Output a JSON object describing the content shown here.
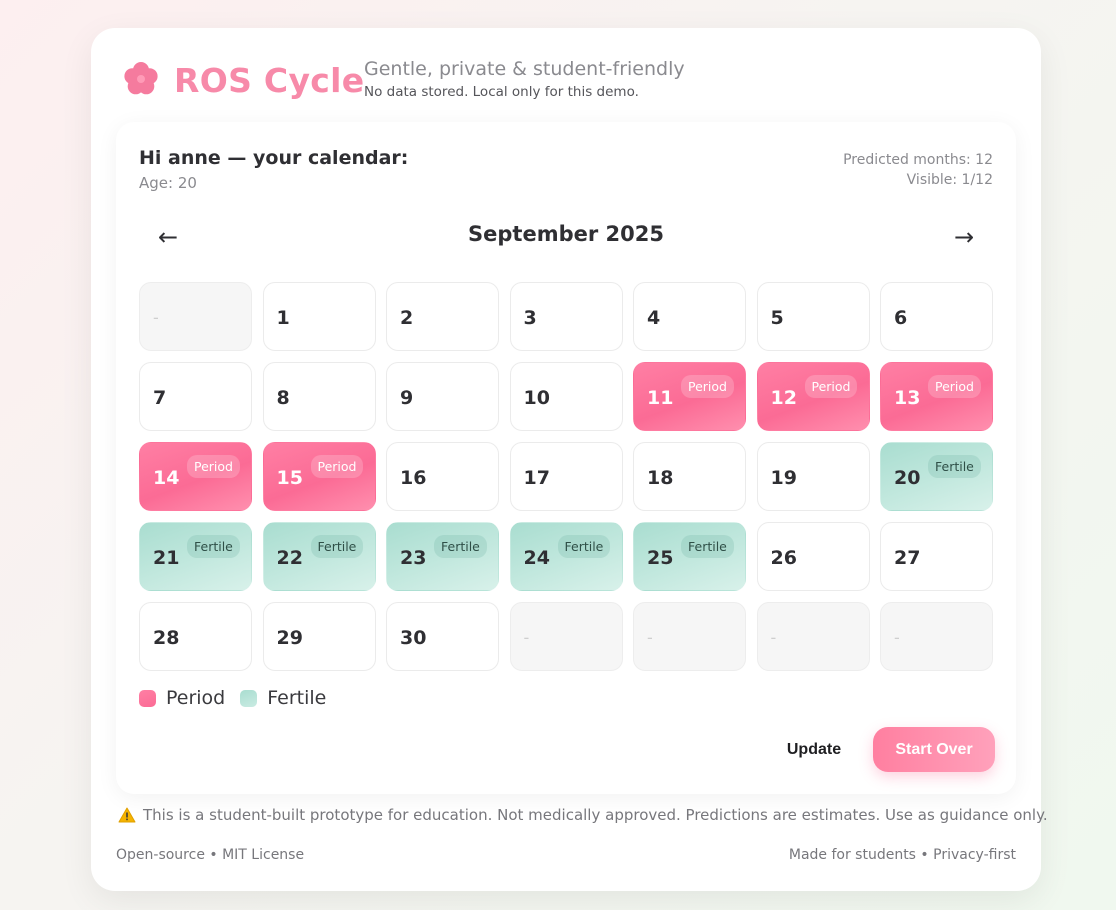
{
  "header": {
    "brand_name": "ROS Cycle",
    "tagline": "Gentle, private & student-friendly",
    "subtagline": "No data stored. Local only for this demo.",
    "brand_color": "#f78aa9",
    "brand_icon": "flower-icon"
  },
  "greeting": {
    "title": "Hi anne — your calendar:",
    "age": "Age: 20"
  },
  "meta": {
    "predicted": "Predicted months: 12",
    "visible": "Visible: 1/12"
  },
  "nav": {
    "prev": "←",
    "next": "→",
    "month": "September 2025"
  },
  "calendar": {
    "empty_placeholder": "-",
    "days": [
      {
        "num": "-",
        "type": "empty"
      },
      {
        "num": "1",
        "type": "normal"
      },
      {
        "num": "2",
        "type": "normal"
      },
      {
        "num": "3",
        "type": "normal"
      },
      {
        "num": "4",
        "type": "normal"
      },
      {
        "num": "5",
        "type": "normal"
      },
      {
        "num": "6",
        "type": "normal"
      },
      {
        "num": "7",
        "type": "normal"
      },
      {
        "num": "8",
        "type": "normal"
      },
      {
        "num": "9",
        "type": "normal"
      },
      {
        "num": "10",
        "type": "normal"
      },
      {
        "num": "11",
        "type": "period",
        "badge": "Period"
      },
      {
        "num": "12",
        "type": "period",
        "badge": "Period"
      },
      {
        "num": "13",
        "type": "period",
        "badge": "Period"
      },
      {
        "num": "14",
        "type": "period",
        "badge": "Period"
      },
      {
        "num": "15",
        "type": "period",
        "badge": "Period"
      },
      {
        "num": "16",
        "type": "normal"
      },
      {
        "num": "17",
        "type": "normal"
      },
      {
        "num": "18",
        "type": "normal"
      },
      {
        "num": "19",
        "type": "normal"
      },
      {
        "num": "20",
        "type": "fertile",
        "badge": "Fertile"
      },
      {
        "num": "21",
        "type": "fertile",
        "badge": "Fertile"
      },
      {
        "num": "22",
        "type": "fertile",
        "badge": "Fertile"
      },
      {
        "num": "23",
        "type": "fertile",
        "badge": "Fertile"
      },
      {
        "num": "24",
        "type": "fertile",
        "badge": "Fertile"
      },
      {
        "num": "25",
        "type": "fertile",
        "badge": "Fertile"
      },
      {
        "num": "26",
        "type": "normal"
      },
      {
        "num": "27",
        "type": "normal"
      },
      {
        "num": "28",
        "type": "normal"
      },
      {
        "num": "29",
        "type": "normal"
      },
      {
        "num": "30",
        "type": "normal"
      },
      {
        "num": "-",
        "type": "empty"
      },
      {
        "num": "-",
        "type": "empty"
      },
      {
        "num": "-",
        "type": "empty"
      },
      {
        "num": "-",
        "type": "empty"
      }
    ]
  },
  "legend": {
    "period": "Period",
    "fertile": "Fertile",
    "period_color": "#fb6b95",
    "fertile_color": "#a9ddd0"
  },
  "actions": {
    "update": "Update",
    "start_over": "Start Over"
  },
  "footer": {
    "disclaimer_icon": "warning-icon",
    "disclaimer": "This is a student-built prototype for education. Not medically approved. Predictions are estimates. Use as guidance only.",
    "left": "Open-source • MIT License",
    "right": "Made for students • Privacy-first"
  }
}
